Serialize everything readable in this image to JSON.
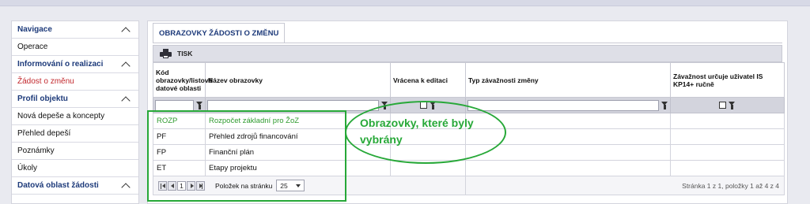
{
  "sidebar": {
    "items": [
      {
        "label": "Navigace",
        "type": "header"
      },
      {
        "label": "Operace",
        "type": "item"
      },
      {
        "label": "Informování o realizaci",
        "type": "header"
      },
      {
        "label": "Žádost o změnu",
        "type": "active"
      },
      {
        "label": "Profil objektu",
        "type": "header"
      },
      {
        "label": "Nová depeše a koncepty",
        "type": "item"
      },
      {
        "label": "Přehled depeší",
        "type": "item"
      },
      {
        "label": "Poznámky",
        "type": "item"
      },
      {
        "label": "Úkoly",
        "type": "item"
      },
      {
        "label": "Datová oblast žádosti",
        "type": "header"
      }
    ]
  },
  "tab": {
    "label": "OBRAZOVKY ŽÁDOSTI O ZMĚNU"
  },
  "toolbar": {
    "print_label": "TISK",
    "print_icon": "printer-icon"
  },
  "table": {
    "columns": [
      {
        "label": "Kód obrazovky/listové datové oblasti"
      },
      {
        "label": "Název obrazovky"
      },
      {
        "label": "Vrácena k editaci"
      },
      {
        "label": "Typ závažnosti změny"
      },
      {
        "label": "Závažnost určuje uživatel IS KP14+ ručně"
      }
    ],
    "rows": [
      {
        "code": "ROZP",
        "name": "Rozpočet základní pro ŽoZ",
        "selected": true
      },
      {
        "code": "PF",
        "name": "Přehled zdrojů financování",
        "selected": false
      },
      {
        "code": "FP",
        "name": "Finanční plán",
        "selected": false
      },
      {
        "code": "ET",
        "name": "Etapy projektu",
        "selected": false
      }
    ],
    "pager": {
      "current_page": "1",
      "per_page_label": "Položek na stránku",
      "per_page_value": "25",
      "info": "Stránka 1 z 1, položky 1 až 4 z 4"
    }
  },
  "annotation": {
    "text": "Obrazovky, které byly vybrány",
    "color": "#27a838"
  },
  "colors": {
    "header_text": "#1d3a7a",
    "active_item": "#c2282d",
    "selected_row": "#2e9b2e"
  }
}
